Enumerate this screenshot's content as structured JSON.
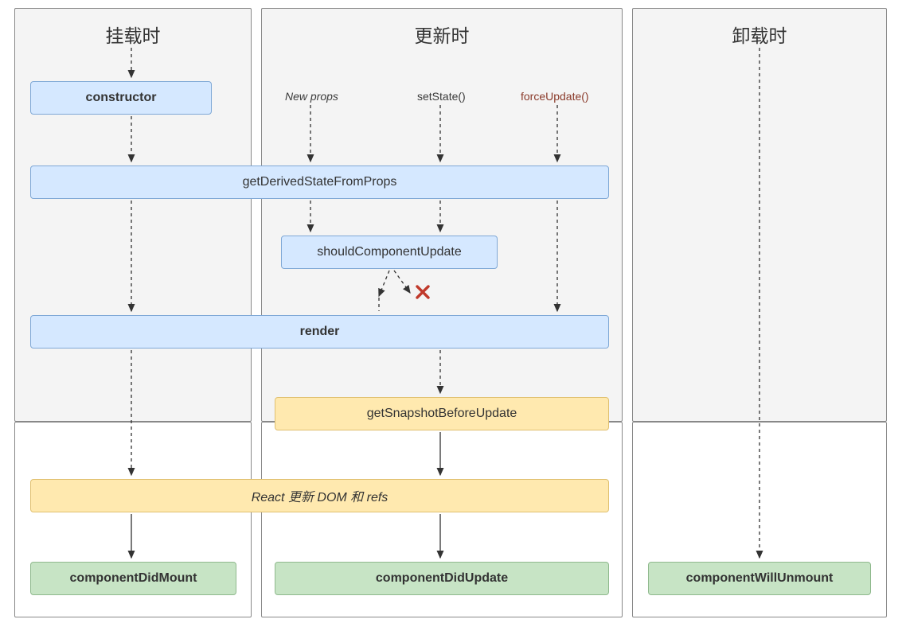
{
  "columns": {
    "mount": {
      "title": "挂载时"
    },
    "update": {
      "title": "更新时"
    },
    "unmount": {
      "title": "卸载时"
    }
  },
  "triggers": {
    "new_props": "New props",
    "set_state": "setState()",
    "force_update": "forceUpdate()"
  },
  "nodes": {
    "constructor": "constructor",
    "get_derived": "getDerivedStateFromProps",
    "should_update": "shouldComponentUpdate",
    "render": "render",
    "get_snapshot": "getSnapshotBeforeUpdate",
    "react_update": "React 更新 DOM 和 refs",
    "did_mount": "componentDidMount",
    "did_update": "componentDidUpdate",
    "will_unmount": "componentWillUnmount"
  },
  "colors": {
    "blue_fill": "#d5e8ff",
    "blue_border": "#7fa8d6",
    "yellow_fill": "#ffe9af",
    "yellow_border": "#e0c070",
    "green_fill": "#c7e4c5",
    "green_border": "#8fb98d",
    "panel_border": "#888",
    "panel_top_bg": "#f4f4f4"
  }
}
